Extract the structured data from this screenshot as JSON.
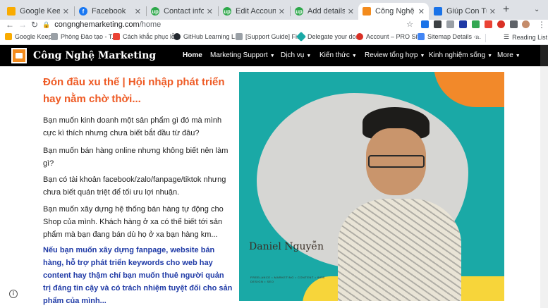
{
  "browser": {
    "tabs": [
      {
        "title": "Google Keep",
        "color": "#f9ab00",
        "active": false
      },
      {
        "title": "Facebook",
        "color": "#1877f2",
        "active": false
      },
      {
        "title": "Contact info",
        "color": "#2da84a",
        "active": false
      },
      {
        "title": "Edit Account Information",
        "color": "#2da84a",
        "active": false
      },
      {
        "title": "Add details",
        "color": "#2da84a",
        "active": false
      },
      {
        "title": "Công Nghệ Marketing",
        "color": "#f38b1d",
        "active": true
      },
      {
        "title": "Giúp Con Tự Tin",
        "color": "#1a73e8",
        "active": false
      }
    ],
    "url_host": "congnghemarketing.com",
    "url_path": "/home",
    "bookmarks": [
      {
        "label": "Google Keep",
        "color": "#f9ab00"
      },
      {
        "label": "Phòng Đào tạo - T...",
        "color": "#9aa0a6"
      },
      {
        "label": "Cách khắc phục lỗ...",
        "color": "#ea4335"
      },
      {
        "label": "GitHub Learning L...",
        "color": "#24292f"
      },
      {
        "label": "[Support Guide] Fi...",
        "color": "#9aa0a6"
      },
      {
        "label": "Delegate your do...",
        "color": "#1aa9a6"
      },
      {
        "label": "Account – PRO Sit...",
        "color": "#d93025"
      },
      {
        "label": "Sitemap Details -...",
        "color": "#4285f4"
      }
    ],
    "reading_list": "Reading List"
  },
  "site": {
    "name": "Công Nghệ Marketing",
    "nav": [
      {
        "label": "Home",
        "dropdown": false
      },
      {
        "label": "Marketing Support",
        "dropdown": true
      },
      {
        "label": "Dịch vụ",
        "dropdown": true
      },
      {
        "label": "Kiến thức",
        "dropdown": true
      },
      {
        "label": "Review tổng hợp",
        "dropdown": true
      },
      {
        "label": "Kinh nghiệm sống",
        "dropdown": true
      },
      {
        "label": "More",
        "dropdown": true
      }
    ]
  },
  "hero": {
    "headline": "Đón đầu xu thế | Hội nhập phát triển hay nằm chờ thời...",
    "paragraphs": [
      "Bạn muốn kinh doanh một sản phẩm gì đó mà mình cực kì thích nhưng chưa biết bắt đầu từ đâu?",
      "Bạn muốn bán hàng online nhưng không biết nên làm gì?",
      "Bạn có tài khoản facebook/zalo/fanpage/tiktok nhưng chưa biết quán triệt để tối ưu lợi nhuận.",
      "Bạn muốn xây dựng hệ thống bán hàng tự động cho Shop của mình. Khách hàng ở xa có thể biết tới sản phẩm mà bạn đang bán dù họ ở xa bạn hàng km..."
    ],
    "highlight": "Nếu bạn muốn xây dựng fanpage, website bán hàng, hỗ trợ phát triển keywords cho web hay content hay thậm chí bạn muốn thuê người quản trị đáng tin cậy và có trách nhiệm tuyệt đối cho sản phẩm của mình..."
  },
  "photo": {
    "name": "Daniel Nguyễn",
    "tagline": "FREELANCE • MARKETING • CONTENT • WEB DESIGN • SEO"
  }
}
